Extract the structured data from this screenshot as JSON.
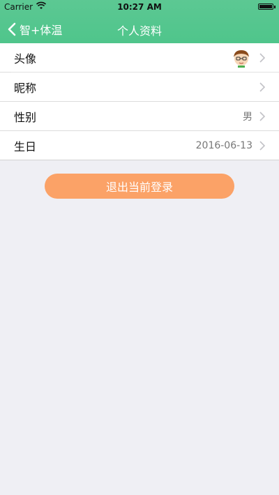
{
  "status_bar": {
    "carrier": "Carrier",
    "time": "10:27 AM"
  },
  "nav": {
    "back_label": "智+体温",
    "title": "个人资料"
  },
  "profile": {
    "rows": [
      {
        "title": "头像",
        "value": ""
      },
      {
        "title": "昵称",
        "value": ""
      },
      {
        "title": "性别",
        "value": "男"
      },
      {
        "title": "生日",
        "value": "2016-06-13"
      }
    ]
  },
  "actions": {
    "logout_label": "退出当前登录"
  },
  "colors": {
    "header": "#52c68c",
    "logout_button": "#fba267",
    "background": "#efeff4"
  },
  "icons": {
    "back": "chevron-left-icon",
    "row_chevron": "chevron-right-icon",
    "avatar": "cartoon-avatar"
  }
}
